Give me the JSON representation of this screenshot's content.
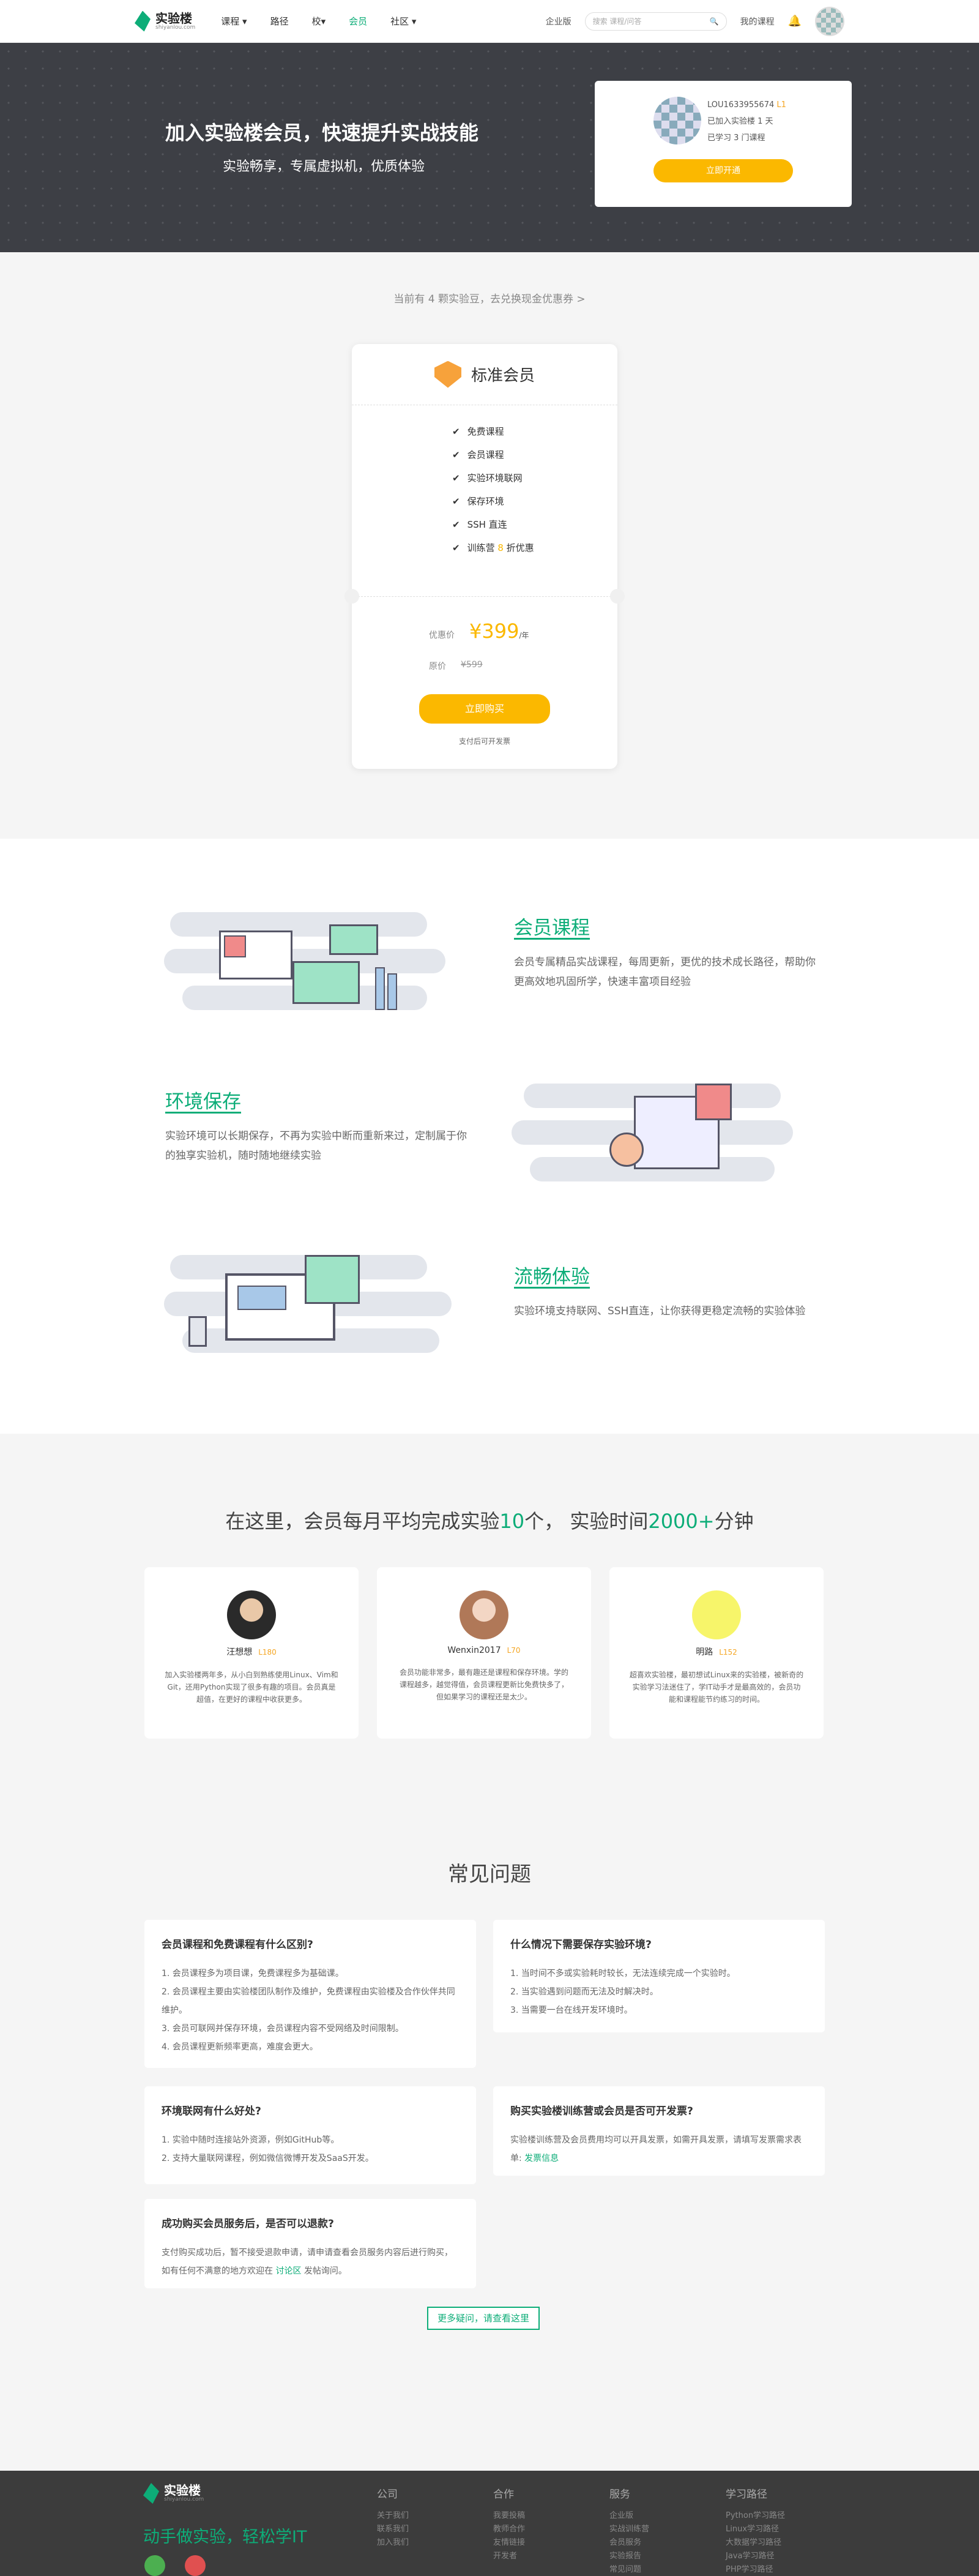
{
  "nav": {
    "logo": "实验楼",
    "logo_sub": "shiyanlou.com",
    "menu": [
      "课程",
      "路径",
      "校",
      "会员",
      "社区"
    ],
    "enterprise": "企业版",
    "search_placeholder": "搜索 课程/问答",
    "my_courses": "我的课程"
  },
  "hero": {
    "title": "加入实验楼会员，快速提升实战技能",
    "subtitle": "实验畅享，专属虚拟机，优质体验",
    "user": {
      "name": "LOU1633955674",
      "level": "L1",
      "joined": "已加入实验楼 1 天",
      "learned": "已学习 3 门课程"
    },
    "btn": "立即开通"
  },
  "coupon": "当前有 4 颗实验豆，去兑换现金优惠券 >",
  "plan": {
    "name": "标准会员",
    "features": [
      "免费课程",
      "会员课程",
      "实验环境联网",
      "保存环境",
      "SSH 直连",
      "训练营 8 折优惠"
    ],
    "price_label": "优惠价",
    "price": "¥399",
    "unit": "/年",
    "orig_label": "原价",
    "orig": "¥599",
    "btn": "立即购买",
    "invoice": "支付后可开发票"
  },
  "features": [
    {
      "title": "会员课程",
      "desc": "会员专属精品实战课程，每周更新，更优的技术成长路径，帮助你更高效地巩固所学，快速丰富项目经验"
    },
    {
      "title": "环境保存",
      "desc": "实验环境可以长期保存，不再为实验中断而重新来过，定制属于你的独享实验机，随时随地继续实验"
    },
    {
      "title": "流畅体验",
      "desc": "实验环境支持联网、SSH直连，让你获得更稳定流畅的实验体验"
    }
  ],
  "stats": {
    "pre": "在这里，会员每月平均完成实验",
    "n1": "10",
    "mid": "个，  实验时间",
    "n2": "2000+",
    "post": "分钟"
  },
  "testimonials": [
    {
      "name": "汪想想",
      "level": "L180",
      "text": "加入实验楼两年多，从小白到熟练使用Linux、Vim和Git，还用Python实现了很多有趣的项目。会员真是超值，在更好的课程中收获更多。"
    },
    {
      "name": "Wenxin2017",
      "level": "L70",
      "text": "会员功能非常多，最有趣还是课程和保存环境。学的课程越多，越觉得值，会员课程更新比免费快多了，但如果学习的课程还是太少。"
    },
    {
      "name": "明路",
      "level": "L152",
      "text": "超喜欢实验楼，最初想试Linux来的实验楼，被新奇的实验学习法迷住了，学IT动手才是最高效的，会员功能和课程能节约练习的时间。"
    }
  ],
  "faq": {
    "title": "常见问题",
    "items": [
      {
        "q": "会员课程和免费课程有什么区别?",
        "a": [
          "1. 会员课程多为项目课，免费课程多为基础课。",
          "2. 会员课程主要由实验楼团队制作及维护，免费课程由实验楼及合作伙伴共同维护。",
          "3. 会员可联网并保存环境，会员课程内容不受网络及时间限制。",
          "4. 会员课程更新频率更高，难度会更大。"
        ]
      },
      {
        "q": "什么情况下需要保存实验环境?",
        "a": [
          "1. 当时间不多或实验耗时较长，无法连续完成一个实验时。",
          "2. 当实验遇到问题而无法及时解决时。",
          "3. 当需要一台在线开发环境时。"
        ]
      },
      {
        "q": "环境联网有什么好处?",
        "a": [
          "1. 实验中随时连接站外资源，例如GitHub等。",
          "2. 支持大量联网课程，例如微信微博开发及SaaS开发。"
        ]
      },
      {
        "q": "购买实验楼训练营或会员是否可开发票?",
        "a": [
          "实验楼训练营及会员费用均可以开具发票，如需开具发票，请填写发票需求表单:"
        ],
        "link": "发票信息"
      },
      {
        "q": "成功购买会员服务后，是否可以退款?",
        "a": [
          "支付购买成功后，暂不接受退款申请，请申请查看会员服务内容后进行购买，如有任何不满意的地方欢迎在"
        ],
        "link": "讨论区",
        "tail": "发帖询问。"
      }
    ],
    "more": "更多疑问，请查看这里"
  },
  "footer": {
    "logo": "实验楼",
    "logo_sub": "shiyanlou.com",
    "slogan": "动手做实验，轻松学IT",
    "cols": [
      {
        "title": "公司",
        "items": [
          "关于我们",
          "联系我们",
          "加入我们"
        ]
      },
      {
        "title": "合作",
        "items": [
          "我要投稿",
          "教师合作",
          "友情链接",
          "开发者"
        ]
      },
      {
        "title": "服务",
        "items": [
          "企业版",
          "实战训练营",
          "会员服务",
          "实验报告",
          "常见问题"
        ]
      },
      {
        "title": "学习路径",
        "items": [
          "Python学习路径",
          "Linux学习路径",
          "大数据学习路径",
          "Java学习路径",
          "PHP学习路径"
        ]
      }
    ]
  },
  "colors": {
    "brand": "#0dad78",
    "accent": "#fbb800",
    "hero_bg": "#3d3f45",
    "footer_bg": "#3c3c3c"
  }
}
